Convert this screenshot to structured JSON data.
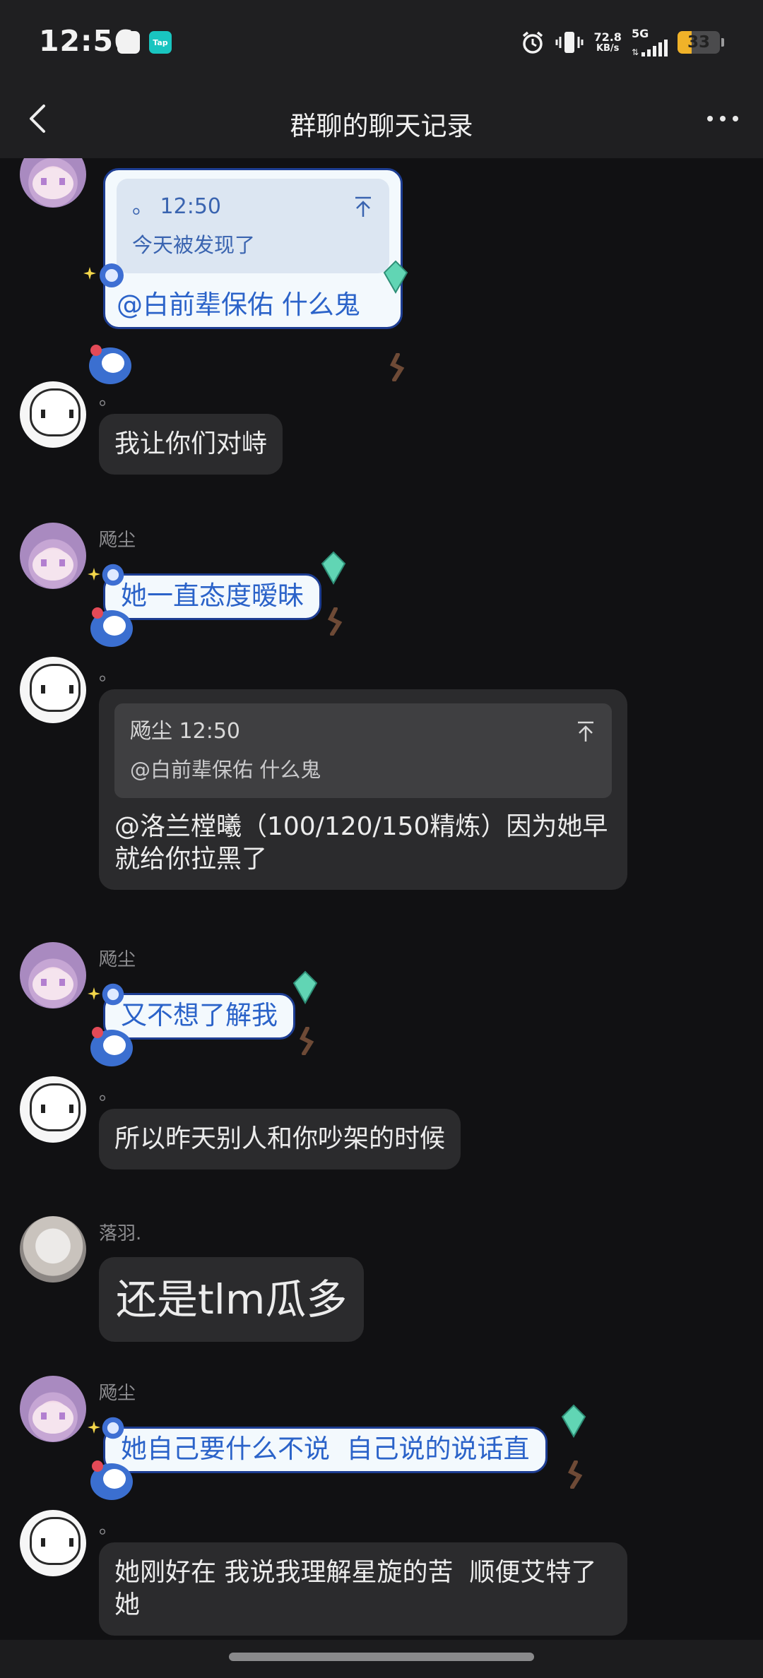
{
  "status_bar": {
    "time": "12:56",
    "app_icons": [
      "qq-icon",
      "taptap-icon"
    ],
    "app_labels": {
      "qq": "",
      "taptap": "Tap"
    },
    "speed_value": "72.8",
    "speed_unit": "KB/s",
    "network": "5G",
    "battery": "33",
    "battery_level": 0.33
  },
  "nav": {
    "title": "群聊的聊天记录"
  },
  "messages": [
    {
      "sender": "",
      "avatar": "avatar-purple",
      "quote": {
        "head": "。 12:50",
        "body": "今天被发现了"
      },
      "text": "@白前辈保佑 什么鬼"
    },
    {
      "sender": "。",
      "avatar": "avatar-white",
      "text": "我让你们对峙"
    },
    {
      "sender": "飏尘",
      "avatar": "avatar-purple",
      "text": "她一直态度暧昧"
    },
    {
      "sender": "。",
      "avatar": "avatar-white",
      "quote": {
        "head": "飏尘 12:50",
        "body": "@白前辈保佑 什么鬼"
      },
      "text": "@洛兰樘曦（100/120/150精炼）因为她早就给你拉黑了"
    },
    {
      "sender": "飏尘",
      "avatar": "avatar-purple",
      "text": "又不想了解我"
    },
    {
      "sender": "。",
      "avatar": "avatar-white",
      "text": "所以昨天别人和你吵架的时候"
    },
    {
      "sender": "落羽.",
      "avatar": "avatar-grey",
      "text": "还是tlm瓜多"
    },
    {
      "sender": "飏尘",
      "avatar": "avatar-purple",
      "text": "她自己要什么不说  自己说的说话直"
    },
    {
      "sender": "。",
      "avatar": "avatar-white",
      "text": "她刚好在 我说我理解星旋的苦  顺便艾特了她"
    }
  ],
  "colors": {
    "background": "#111113",
    "bar": "#1f1f21",
    "bubble": "#2b2b2d",
    "deco_bubble_text": "#2b63c9",
    "battery": "#f0b229"
  }
}
